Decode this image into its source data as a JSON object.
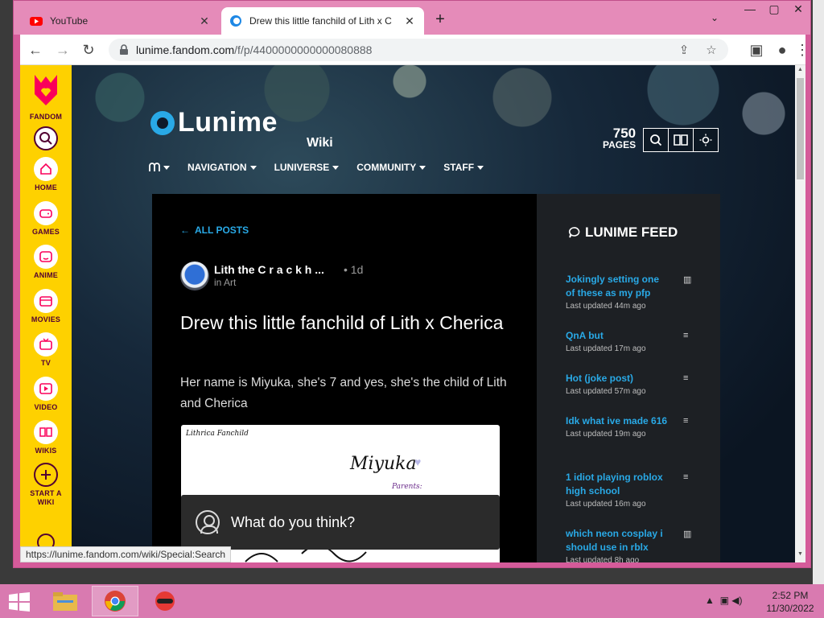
{
  "browser": {
    "tabs": [
      {
        "title": "YouTube",
        "icon": "youtube-icon",
        "active": false
      },
      {
        "title": "Drew this little fanchild of Lith x C",
        "icon": "fandom-tab-icon",
        "active": true
      }
    ],
    "url_host": "lunime.fandom.com",
    "url_path": "/f/p/4400000000000080888",
    "status_url": "https://lunime.fandom.com/wiki/Special:Search"
  },
  "fandom_rail": {
    "brand": "FANDOM",
    "items": [
      {
        "label": "HOME",
        "icon": "home-icon"
      },
      {
        "label": "GAMES",
        "icon": "gamepad-icon"
      },
      {
        "label": "ANIME",
        "icon": "anime-icon"
      },
      {
        "label": "MOVIES",
        "icon": "movie-icon"
      },
      {
        "label": "TV",
        "icon": "tv-icon"
      },
      {
        "label": "VIDEO",
        "icon": "video-icon"
      },
      {
        "label": "WIKIS",
        "icon": "wikis-icon"
      },
      {
        "label": "START A WIKI",
        "icon": "plus-icon"
      }
    ]
  },
  "wiki": {
    "name": "Lunime",
    "tag": "Wiki",
    "pages_count": "750",
    "pages_label": "PAGES",
    "nav": [
      "NAVIGATION",
      "LUNIVERSE",
      "COMMUNITY",
      "STAFF"
    ]
  },
  "post": {
    "back_label": "ALL POSTS",
    "author": "Lith the C r a c k h ...",
    "time": "• 1d",
    "category": "in Art",
    "title": "Drew this little fanchild of Lith x Cherica",
    "body": "Her name is Miyuka, she's 7 and yes, she's the child of Lith and Cherica",
    "image_caption": "Lithrica Fanchild",
    "image_name": "Miyuka",
    "image_parents": "Parents:",
    "comment_placeholder": "What do you think?"
  },
  "feed": {
    "title": "LUNIME FEED",
    "items": [
      {
        "title": "Jokingly setting one of these as my pfp",
        "updated": "Last updated 44m ago",
        "kind": "poll-icon"
      },
      {
        "title": "QnA but",
        "updated": "Last updated 17m ago",
        "kind": "text-icon"
      },
      {
        "title": "Hot (joke post)",
        "updated": "Last updated 57m ago",
        "kind": "text-icon"
      },
      {
        "title": "Idk what ive made 616",
        "updated": "Last updated 19m ago",
        "kind": "text-icon"
      },
      {
        "title": "1 idiot playing roblox high school",
        "updated": "Last updated 16m ago",
        "kind": "text-icon"
      },
      {
        "title": "which neon cosplay i should use in rblx",
        "updated": "Last updated 8h ago",
        "kind": "poll-icon"
      }
    ]
  },
  "taskbar": {
    "time": "2:52 PM",
    "date": "11/30/2022"
  },
  "colors": {
    "fandom_yellow": "#fed100",
    "link_blue": "#29a9e6",
    "window_pink": "#d55b9a"
  }
}
